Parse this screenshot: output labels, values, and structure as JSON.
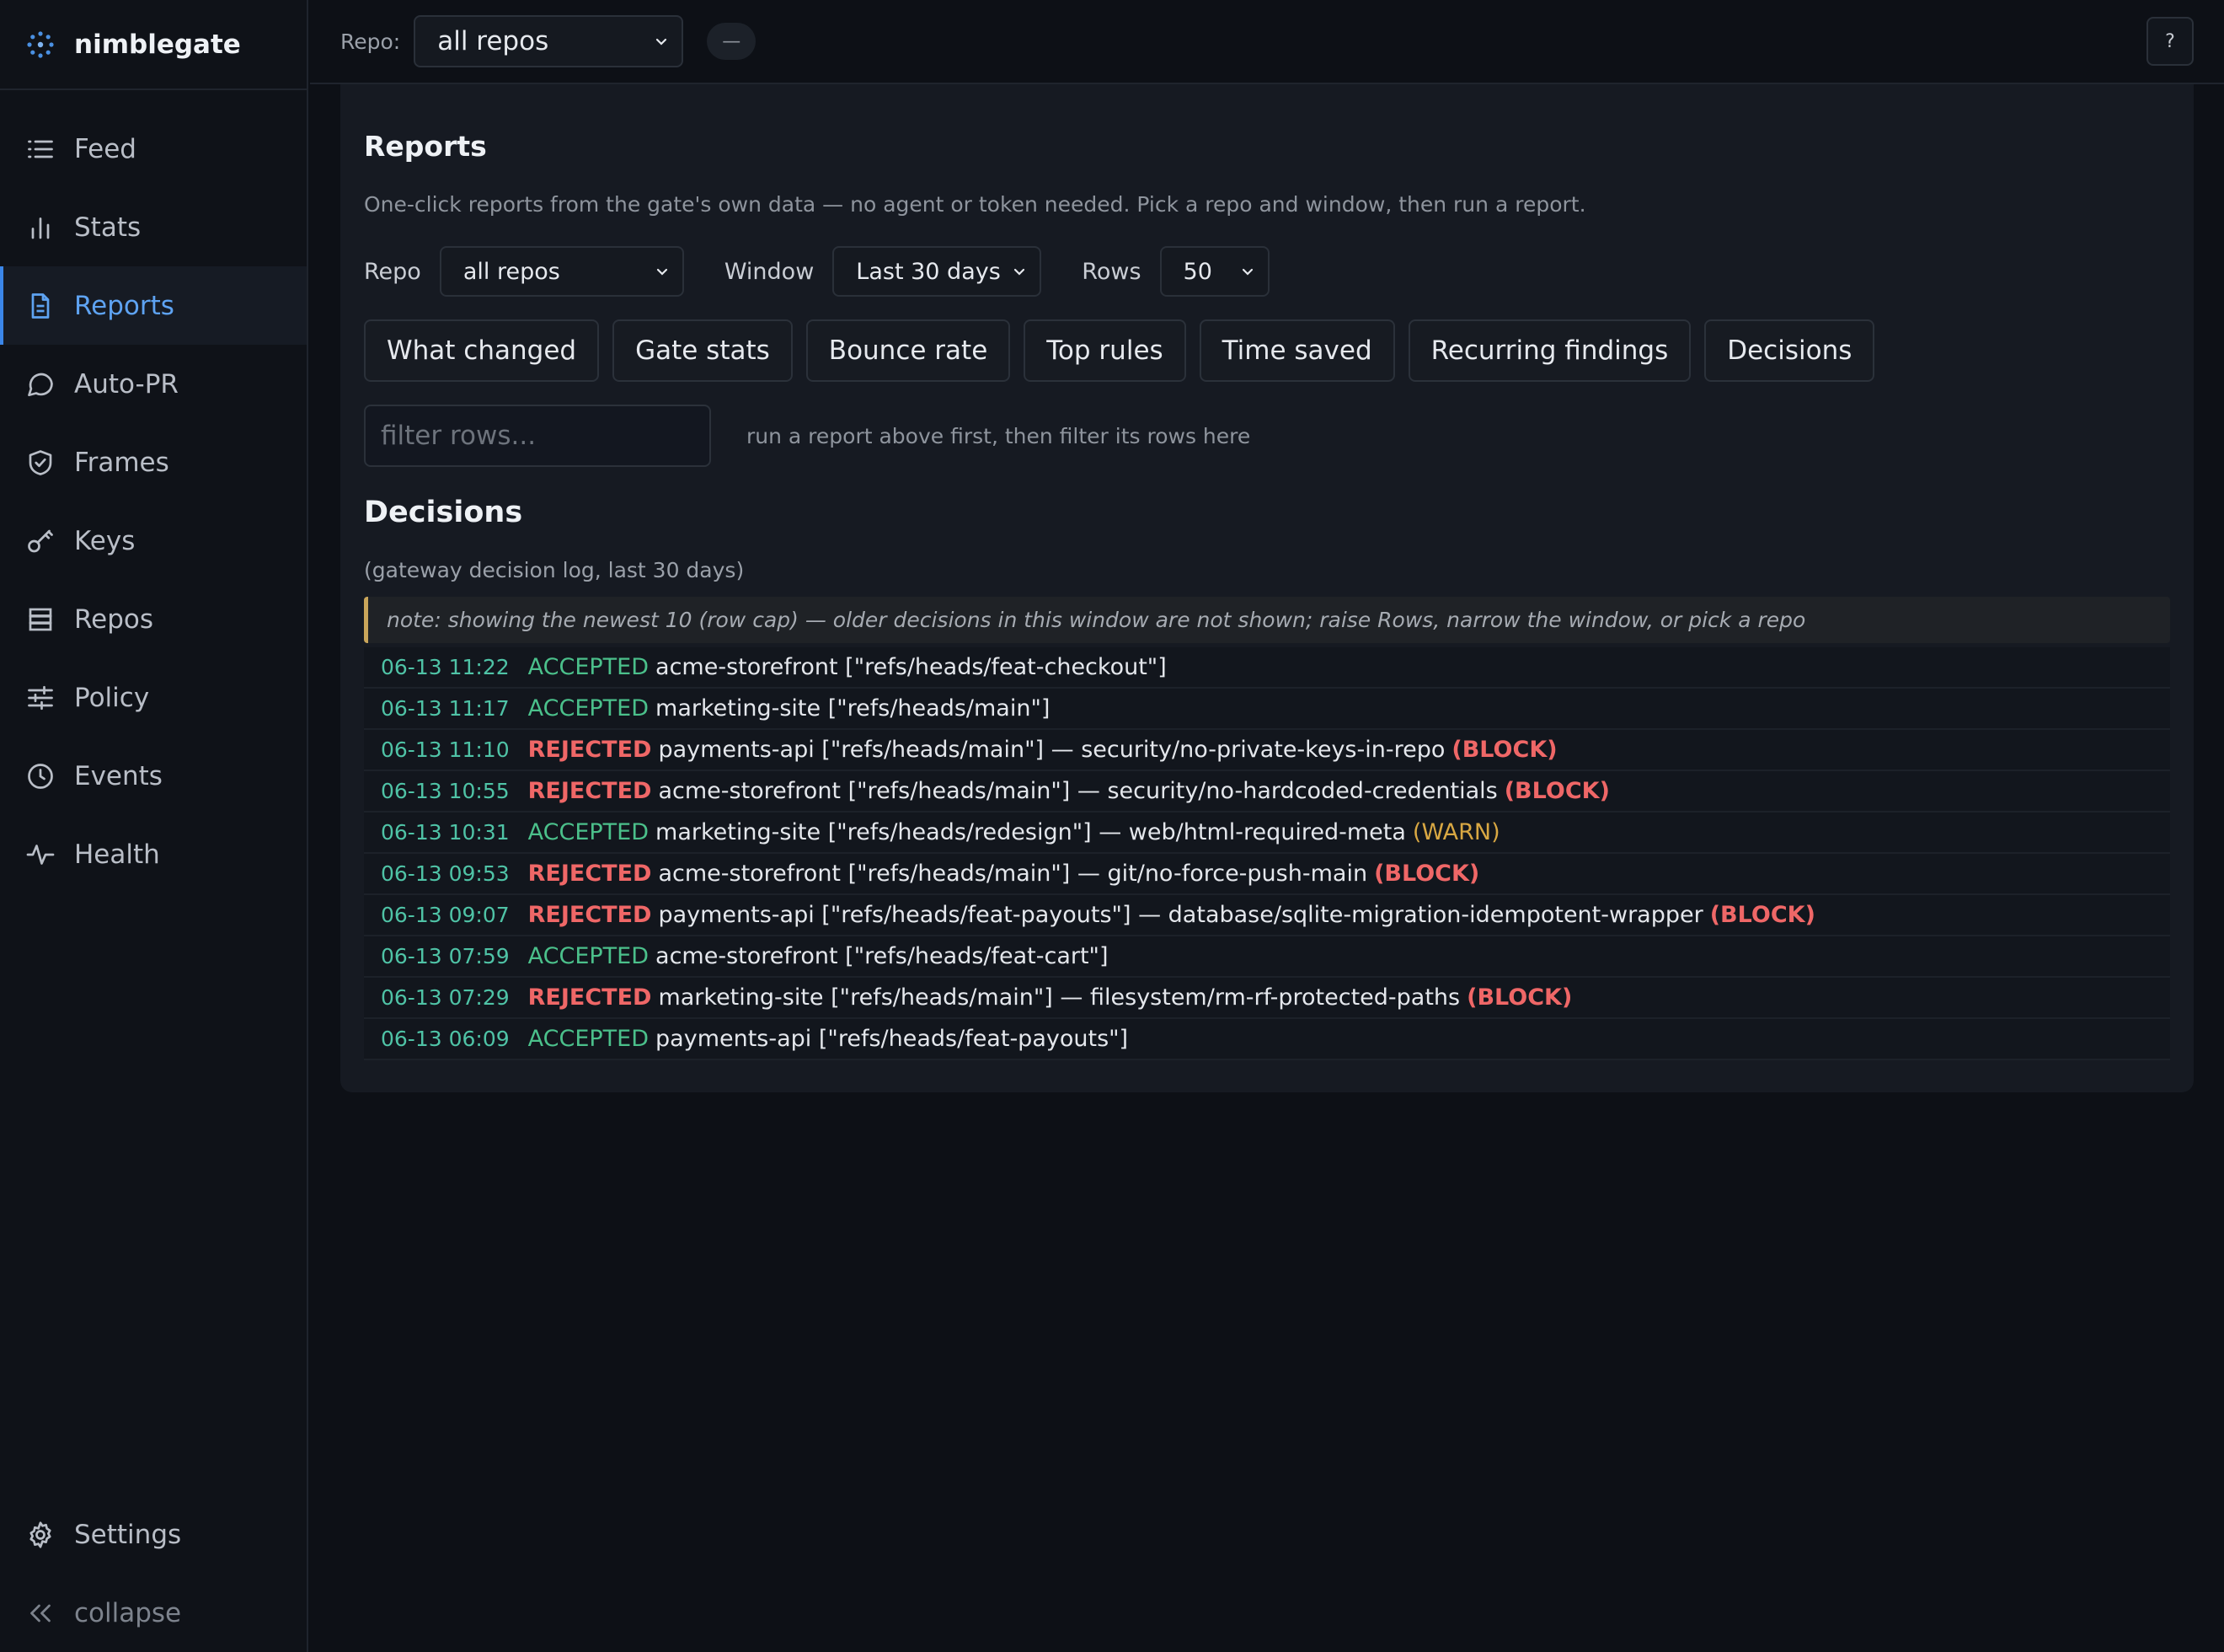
{
  "brand": {
    "name": "nimblegate"
  },
  "sidebar": {
    "items": [
      {
        "label": "Feed",
        "icon": "list-icon",
        "active": false
      },
      {
        "label": "Stats",
        "icon": "bar-chart-icon",
        "active": false
      },
      {
        "label": "Reports",
        "icon": "document-icon",
        "active": true
      },
      {
        "label": "Auto-PR",
        "icon": "chat-bubble-icon",
        "active": false
      },
      {
        "label": "Frames",
        "icon": "shield-check-icon",
        "active": false
      },
      {
        "label": "Keys",
        "icon": "key-icon",
        "active": false
      },
      {
        "label": "Repos",
        "icon": "database-icon",
        "active": false
      },
      {
        "label": "Policy",
        "icon": "sliders-icon",
        "active": false
      },
      {
        "label": "Events",
        "icon": "clock-icon",
        "active": false
      },
      {
        "label": "Health",
        "icon": "pulse-icon",
        "active": false
      }
    ],
    "settings_label": "Settings",
    "collapse_label": "collapse"
  },
  "topbar": {
    "repo_label": "Repo:",
    "repo_value": "all repos",
    "pill_label": "—",
    "help_label": "?"
  },
  "reports": {
    "title": "Reports",
    "description": "One-click reports from the gate's own data — no agent or token needed. Pick a repo and window, then run a report.",
    "repo_label": "Repo",
    "repo_value": "all repos",
    "window_label": "Window",
    "window_value": "Last 30 days",
    "rows_label": "Rows",
    "rows_value": "50",
    "buttons": [
      "What changed",
      "Gate stats",
      "Bounce rate",
      "Top rules",
      "Time saved",
      "Recurring findings",
      "Decisions"
    ],
    "filter_placeholder": "filter rows...",
    "filter_hint": "run a report above first, then filter its rows here"
  },
  "decisions": {
    "title": "Decisions",
    "subtitle": "(gateway decision log, last 30 days)",
    "note": "note: showing the newest 10 (row cap) — older decisions in this window are not shown; raise Rows, narrow the window, or pick a repo",
    "rows": [
      {
        "time": "06-13 11:22",
        "status": "ACCEPTED",
        "message": "acme-storefront [\"refs/heads/feat-checkout\"]",
        "severity": ""
      },
      {
        "time": "06-13 11:17",
        "status": "ACCEPTED",
        "message": "marketing-site [\"refs/heads/main\"]",
        "severity": ""
      },
      {
        "time": "06-13 11:10",
        "status": "REJECTED",
        "message": "payments-api [\"refs/heads/main\"] — security/no-private-keys-in-repo",
        "severity": "(BLOCK)"
      },
      {
        "time": "06-13 10:55",
        "status": "REJECTED",
        "message": "acme-storefront [\"refs/heads/main\"] — security/no-hardcoded-credentials",
        "severity": "(BLOCK)"
      },
      {
        "time": "06-13 10:31",
        "status": "ACCEPTED",
        "message": "marketing-site [\"refs/heads/redesign\"] — web/html-required-meta",
        "severity": "(WARN)"
      },
      {
        "time": "06-13 09:53",
        "status": "REJECTED",
        "message": "acme-storefront [\"refs/heads/main\"] — git/no-force-push-main",
        "severity": "(BLOCK)"
      },
      {
        "time": "06-13 09:07",
        "status": "REJECTED",
        "message": "payments-api [\"refs/heads/feat-payouts\"] — database/sqlite-migration-idempotent-wrapper",
        "severity": "(BLOCK)"
      },
      {
        "time": "06-13 07:59",
        "status": "ACCEPTED",
        "message": "acme-storefront [\"refs/heads/feat-cart\"]",
        "severity": ""
      },
      {
        "time": "06-13 07:29",
        "status": "REJECTED",
        "message": "marketing-site [\"refs/heads/main\"] — filesystem/rm-rf-protected-paths",
        "severity": "(BLOCK)"
      },
      {
        "time": "06-13 06:09",
        "status": "ACCEPTED",
        "message": "payments-api [\"refs/heads/feat-payouts\"]",
        "severity": ""
      }
    ]
  },
  "colors": {
    "accent": "#3b86e8",
    "accepted": "#4bc08b",
    "rejected": "#ef6767",
    "warn": "#d9a843",
    "note_border": "#c9a55a"
  }
}
